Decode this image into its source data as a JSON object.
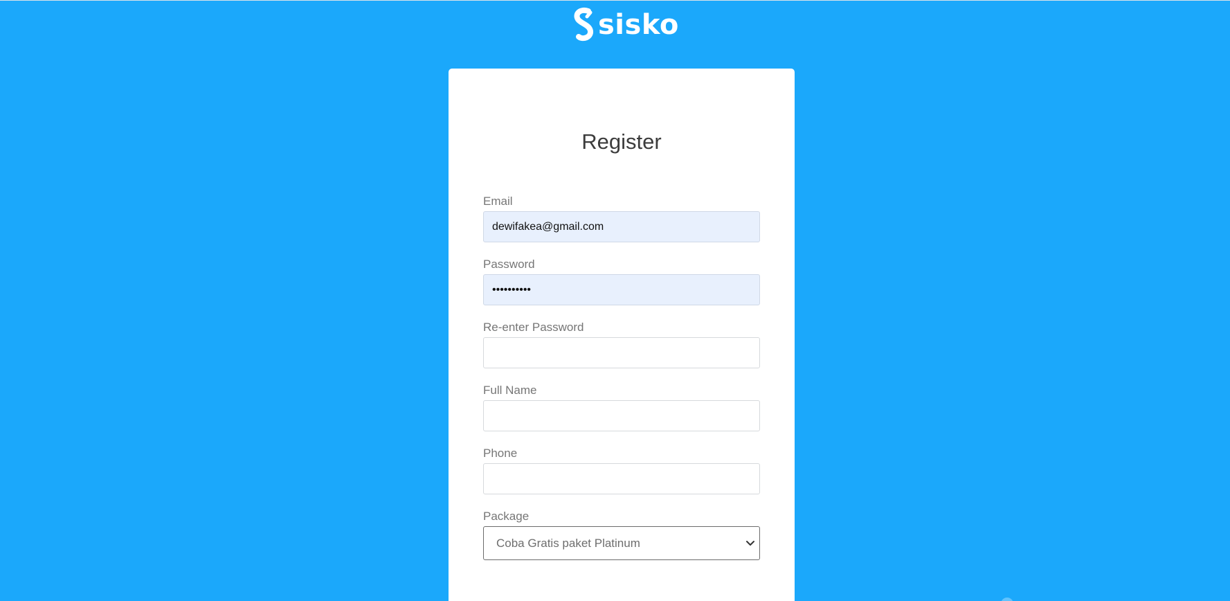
{
  "brand": {
    "logo_text": "sisko",
    "logo_icon": "sisko-s-logo-icon"
  },
  "form": {
    "title": "Register",
    "fields": [
      {
        "label": "Email",
        "value": "dewifakea@gmail.com",
        "type": "text"
      },
      {
        "label": "Password",
        "value": "••••••••••",
        "type": "password"
      },
      {
        "label": "Re-enter Password",
        "value": "",
        "type": "password"
      },
      {
        "label": "Full Name",
        "value": "",
        "type": "text"
      },
      {
        "label": "Phone",
        "value": "",
        "type": "text"
      }
    ],
    "package": {
      "label": "Package",
      "selected": "Coba Gratis paket Platinum",
      "icon": "chevron-down-icon"
    }
  },
  "colors": {
    "background": "#1ba8fb",
    "card": "#ffffff",
    "autofill": "#e8f0fd"
  }
}
